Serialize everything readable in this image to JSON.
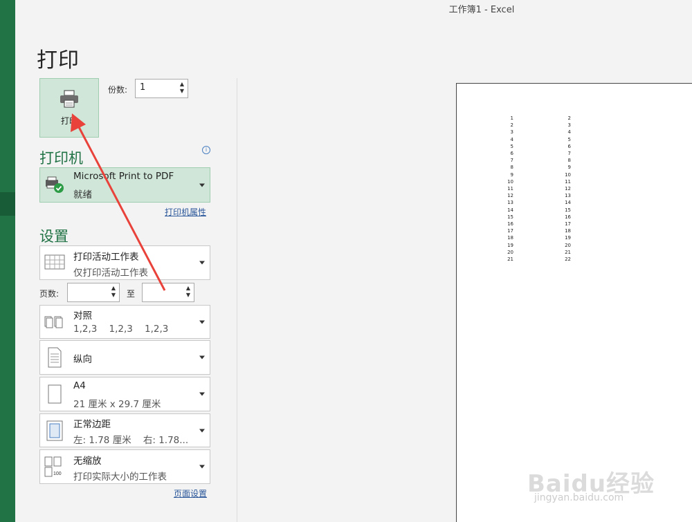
{
  "window": {
    "title": "工作簿1  -  Excel"
  },
  "page_title": "打印",
  "print_button": {
    "label": "打印",
    "icon": "printer-icon"
  },
  "copies": {
    "label": "份数:",
    "value": "1"
  },
  "printer_section": {
    "heading": "打印机",
    "printer": {
      "name": "Microsoft Print to PDF",
      "status": "就绪",
      "icon": "printer-ready-icon"
    },
    "properties_link": "打印机属性"
  },
  "settings_section": {
    "heading": "设置",
    "scope": {
      "line1": "打印活动工作表",
      "line2": "仅打印活动工作表"
    },
    "pages": {
      "label": "页数:",
      "to_label": "至",
      "from_value": "",
      "to_value": ""
    },
    "collation": {
      "line1": "对照",
      "line2": "1,2,3    1,2,3    1,2,3"
    },
    "orientation": {
      "line1": "纵向"
    },
    "paper": {
      "line1": "A4",
      "line2": "21 厘米 x 29.7 厘米"
    },
    "margins": {
      "line1": "正常边距",
      "line2": "左: 1.78 厘米    右: 1.78..."
    },
    "scaling": {
      "line1": "无缩放",
      "line2": "打印实际大小的工作表",
      "icon_text": "100"
    },
    "page_setup_link": "页面设置"
  },
  "preview": {
    "col1": [
      "1",
      "2",
      "3",
      "4",
      "5",
      "6",
      "7",
      "8",
      "9",
      "10",
      "11",
      "12",
      "13",
      "14",
      "15",
      "16",
      "17",
      "18",
      "19",
      "20",
      "21"
    ],
    "col2": [
      "2",
      "3",
      "4",
      "5",
      "6",
      "7",
      "8",
      "9",
      "10",
      "11",
      "12",
      "13",
      "14",
      "15",
      "16",
      "17",
      "18",
      "19",
      "20",
      "21",
      "22"
    ]
  },
  "watermark": {
    "brand": "Baidu经验",
    "url": "jingyan.baidu.com"
  },
  "colors": {
    "accent": "#217346",
    "selected_bg": "#cfe6d8",
    "annotation_arrow": "#e8423a"
  }
}
